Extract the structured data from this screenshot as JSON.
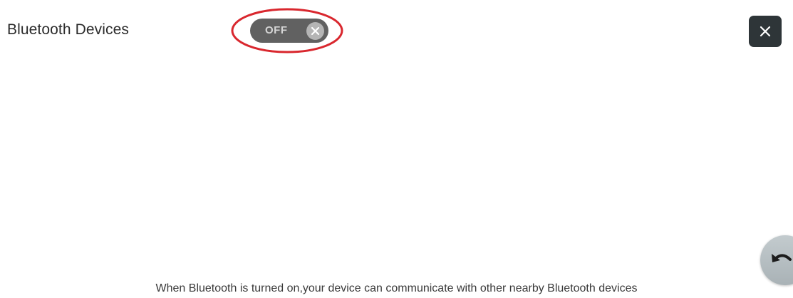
{
  "header": {
    "title": "Bluetooth Devices"
  },
  "bluetooth_toggle": {
    "label": "OFF",
    "state": "off",
    "knob_icon": "x-icon",
    "highlight_color": "#d9272e"
  },
  "close_button": {
    "icon": "close-icon"
  },
  "back_button": {
    "icon": "undo-icon"
  },
  "footer": {
    "info_text": "When Bluetooth is turned on,your device can communicate with other nearby Bluetooth devices"
  },
  "colors": {
    "background": "#ffffff",
    "toggle_track": "#616161",
    "close_button": "#2e3538",
    "back_button": "#b7c0c4"
  }
}
